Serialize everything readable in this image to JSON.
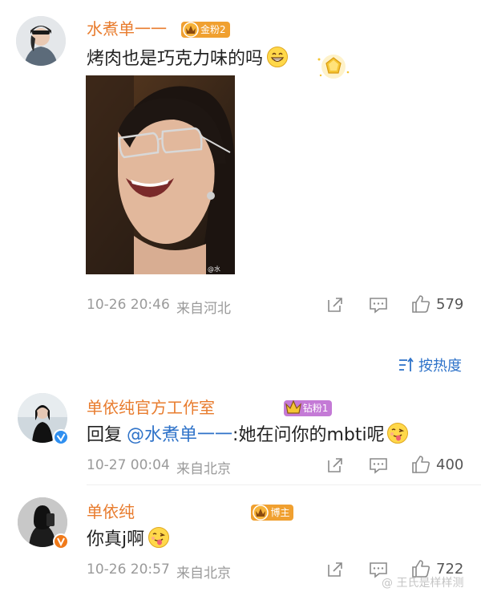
{
  "colors": {
    "name": "#e87c2e",
    "mention": "#2f73c9",
    "meta": "#9a9a9a",
    "gold_badge": "#f0a030",
    "diamond_badge": "#c47ad6",
    "blogger_badge": "#f0a030"
  },
  "comment1": {
    "username": "水煮单一一",
    "badge": "金粉2",
    "text": "烤肉也是巧克力味的吗",
    "timestamp": "10-26 20:46",
    "location": "来自河北",
    "likes": "579",
    "image_watermark": "@水"
  },
  "sort": {
    "label": "按热度"
  },
  "reply1": {
    "username": "单依纯官方工作室",
    "badge": "钻粉1",
    "prefix": "回复",
    "mention": "@水煮单一一",
    "text": ":她在问你的mbti呢",
    "timestamp": "10-27 00:04",
    "location": "来自北京",
    "likes": "400"
  },
  "reply2": {
    "username": "单依纯",
    "badge": "博主",
    "text": "你真j啊",
    "timestamp": "10-26 20:57",
    "location": "来自北京",
    "likes": "722"
  },
  "watermark": "@ 王氏是样样测"
}
